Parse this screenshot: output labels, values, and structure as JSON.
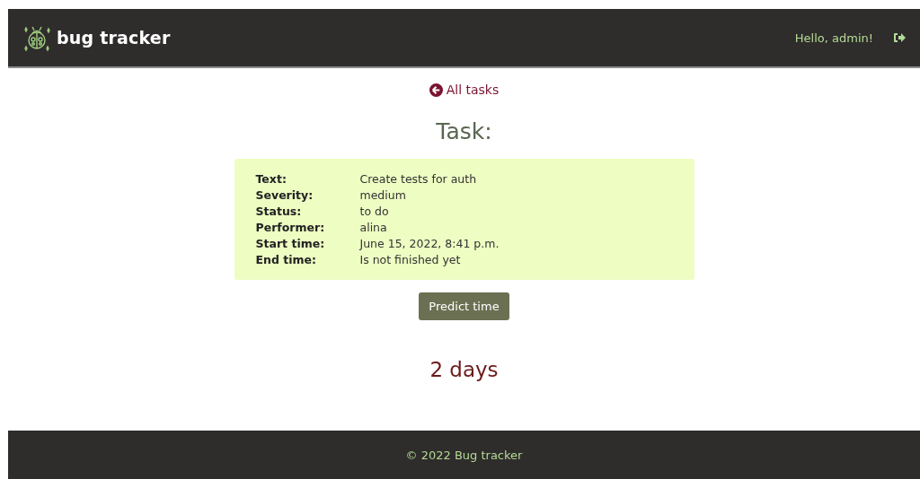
{
  "header": {
    "brand": "bug tracker",
    "greeting": "Hello, admin!"
  },
  "back_link": "All tasks",
  "title": "Task:",
  "details": [
    {
      "label": "Text:",
      "value": "Create tests for auth"
    },
    {
      "label": "Severity:",
      "value": "medium"
    },
    {
      "label": "Status:",
      "value": "to do"
    },
    {
      "label": "Performer:",
      "value": "alina"
    },
    {
      "label": "Start time:",
      "value": "June 15, 2022, 8:41 p.m."
    },
    {
      "label": "End time:",
      "value": "Is not finished yet"
    }
  ],
  "predict_button": "Predict time",
  "prediction": "2 days",
  "footer": "© 2022 Bug tracker"
}
